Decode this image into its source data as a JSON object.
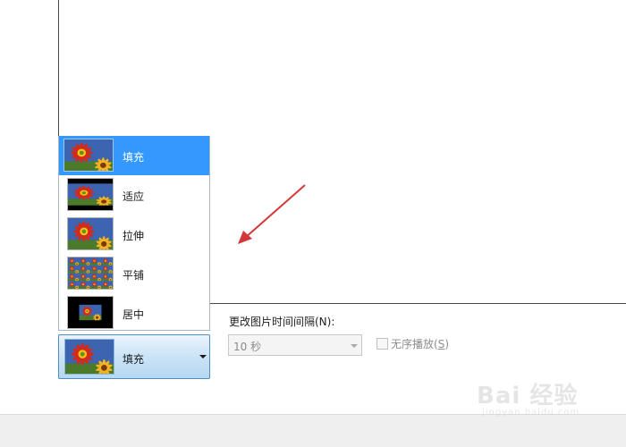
{
  "picture_position": {
    "options": [
      {
        "label": "填充",
        "icon": "wallpaper-fill-thumbnail-icon",
        "selected": true
      },
      {
        "label": "适应",
        "icon": "wallpaper-fit-thumbnail-icon",
        "selected": false
      },
      {
        "label": "拉伸",
        "icon": "wallpaper-stretch-thumbnail-icon",
        "selected": false
      },
      {
        "label": "平铺",
        "icon": "wallpaper-tile-thumbnail-icon",
        "selected": false
      },
      {
        "label": "居中",
        "icon": "wallpaper-center-thumbnail-icon",
        "selected": false
      }
    ],
    "current_label": "填充",
    "current_icon": "wallpaper-fill-thumbnail-icon"
  },
  "interval": {
    "label": "更改图片时间间隔(N):",
    "value": "10 秒"
  },
  "shuffle": {
    "label": "无序播放",
    "accelerator": "S",
    "checked": false
  },
  "colors": {
    "selection": "#3399ff",
    "arrow": "#d4373a",
    "combo_border": "#4f8ec4"
  },
  "watermark": {
    "main": "Bai 经验",
    "sub": "jingyan.baidu.com"
  }
}
